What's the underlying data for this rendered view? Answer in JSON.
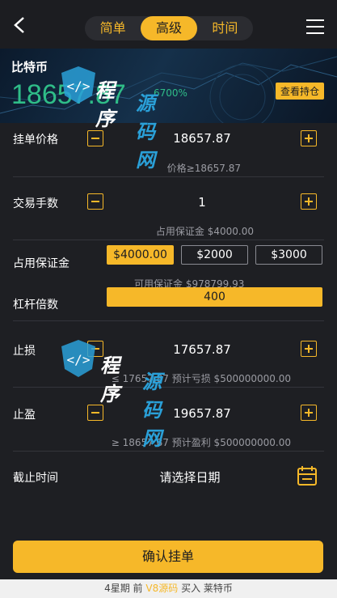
{
  "header": {
    "tabs": [
      {
        "label": "简单",
        "active": false
      },
      {
        "label": "高级",
        "active": true
      },
      {
        "label": "时间",
        "active": false
      }
    ]
  },
  "banner": {
    "coin_name": "比特币",
    "price": "18657.87",
    "change": "6700%",
    "view_positions_label": "查看持仓"
  },
  "order_price": {
    "label": "挂单价格",
    "value": "18657.87",
    "hint": "价格≥18657.87"
  },
  "fee": {
    "label": "交易手数",
    "value": "1",
    "hint": "占用保证金 $4000.00"
  },
  "margin": {
    "label": "占用保证金",
    "options": [
      "$4000.00",
      "$2000",
      "$3000"
    ],
    "selected_index": 0,
    "available": "可用保证金 $978799.93"
  },
  "leverage": {
    "label": "杠杆倍数",
    "value": "400"
  },
  "stop_loss": {
    "label": "止损",
    "value": "17657.87",
    "hint": "≤ 17657.87 预计亏损 $500000000.00"
  },
  "take_profit": {
    "label": "止盈",
    "value": "19657.87",
    "hint": "≥ 18657.87 预计盈利 $500000000.00"
  },
  "deadline": {
    "label": "截止时间",
    "placeholder": "请选择日期"
  },
  "confirm_label": "确认挂单",
  "footer": {
    "prefix": "4星期 前",
    "accent": "V8源码",
    "suffix": "买入 莱特币"
  },
  "watermark": {
    "line_a": "程序",
    "line_b": "源码网"
  },
  "colors": {
    "accent": "#f6b829",
    "up": "#2fbd88",
    "background": "#1e1f23"
  }
}
